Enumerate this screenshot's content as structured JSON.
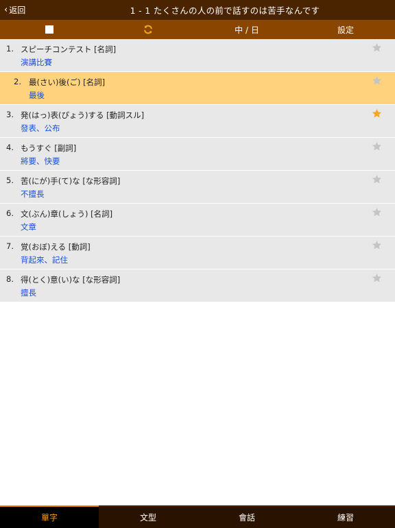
{
  "navbar": {
    "back_label": "返回",
    "title": "1 - 1 たくさんの人の前で話すのは苦手なんです"
  },
  "toolbar": {
    "lang_label": "中 / 日",
    "settings_label": "設定",
    "refresh_color": "#f5a623"
  },
  "vocab": [
    {
      "num": "1.",
      "word": "スピーチコンテスト  [名詞]",
      "meaning": "演講比賽",
      "starred": false,
      "selected": false
    },
    {
      "num": "2.",
      "word": "最(さい)後(ご)  [名詞]",
      "meaning": "最後",
      "starred": false,
      "selected": true
    },
    {
      "num": "3.",
      "word": "発(はっ)表(ぴょう)する  [動詞スル]",
      "meaning": "發表、公布",
      "starred": true,
      "selected": false
    },
    {
      "num": "4.",
      "word": "もうすぐ  [副詞]",
      "meaning": "將要、快要",
      "starred": false,
      "selected": false
    },
    {
      "num": "5.",
      "word": "苦(にが)手(て)な  [な形容詞]",
      "meaning": "不擅長",
      "starred": false,
      "selected": false
    },
    {
      "num": "6.",
      "word": "文(ぶん)章(しょう)  [名詞]",
      "meaning": "文章",
      "starred": false,
      "selected": false
    },
    {
      "num": "7.",
      "word": "覚(おぼ)える  [動詞]",
      "meaning": "背起來、記住",
      "starred": false,
      "selected": false
    },
    {
      "num": "8.",
      "word": "得(とく)意(い)な  [な形容詞]",
      "meaning": "擅長",
      "starred": false,
      "selected": false
    }
  ],
  "colors": {
    "star_on": "#f5a623",
    "star_off": "#c4c4c4",
    "meaning": "#1a4fd6",
    "selected_row": "#ffd27e"
  },
  "tabs": [
    {
      "label": "單字",
      "active": true
    },
    {
      "label": "文型",
      "active": false
    },
    {
      "label": "會話",
      "active": false
    },
    {
      "label": "練習",
      "active": false
    }
  ]
}
